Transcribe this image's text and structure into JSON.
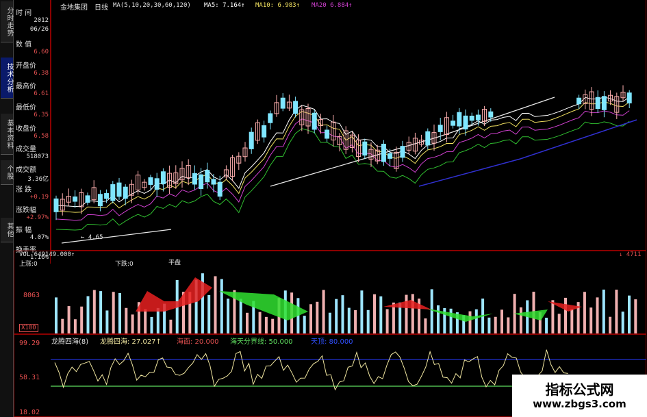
{
  "side_tabs": [
    {
      "label": "分时走势",
      "active": false
    },
    {
      "label": "技术分析",
      "active": true
    },
    {
      "label": "基本资料",
      "active": false
    },
    {
      "label": "个股",
      "active": false
    },
    {
      "label": "其他",
      "active": false
    }
  ],
  "info_panel": [
    {
      "label": "时  间",
      "value": "2012",
      "value2": "06/26",
      "color": "#e0e0e0"
    },
    {
      "label": "数  值",
      "value": "6.60",
      "color": "#e05050"
    },
    {
      "label": "开盘价",
      "value": "6.38",
      "color": "#e05050"
    },
    {
      "label": "最高价",
      "value": "6.61",
      "color": "#e05050"
    },
    {
      "label": "最低价",
      "value": "6.35",
      "color": "#e05050"
    },
    {
      "label": "收盘价",
      "value": "6.58",
      "color": "#e05050"
    },
    {
      "label": "成交量",
      "value": "518073",
      "color": "#e0e0e0"
    },
    {
      "label": "成交额",
      "value": "3.36亿",
      "color": "#e0e0e0"
    },
    {
      "label": "涨  跌",
      "value": "+0.19",
      "color": "#e05050"
    },
    {
      "label": "涨跌幅",
      "value": "+2.97%",
      "color": "#e05050"
    },
    {
      "label": "振  幅",
      "value": "4.07%",
      "color": "#e0e0e0"
    },
    {
      "label": "换手率",
      "value": "1.16%",
      "color": "#e0e0e0"
    }
  ],
  "main_chart": {
    "stock_name": "金地集团",
    "period": "日线",
    "ma_spec": "MA(5,10,20,30,60,120)",
    "ma5": "MA5: 7.164↑",
    "ma10": "MA10: 6.983↑",
    "ma20": "MA20  6.884↑",
    "low_marker": "← 4.65",
    "colors": {
      "up": "#ffb0b0",
      "down": "#7fe6ff",
      "ma5": "#ffffff",
      "ma10": "#f0e060",
      "ma20": "#d040d0",
      "ma30": "#30c030",
      "ma60": "#e8e8e8",
      "ma120": "#3030d0"
    }
  },
  "volume_panel": {
    "header": "VOL 649149.000↑",
    "right_header": "↓ 4711",
    "sub_label_a": "上涨:0",
    "sub_label_b": "下跌:0",
    "sub_label_c": "平盘",
    "axis_top": "8063",
    "axis_bottom": "X100"
  },
  "indicator_panel": {
    "name": "龙腾四海(8)",
    "line_label": "龙腾四海: 27.027↑",
    "sea_label": "海面: 20.000",
    "sky_label": "海天分界线: 50.000",
    "sky_top_label": "天顶: 80.000",
    "axis_top": "99.29",
    "axis_mid": "58.31",
    "axis_bottom": "18.02"
  },
  "watermark": {
    "title": "指标公式网",
    "url": "www.zbgs3.com"
  }
}
